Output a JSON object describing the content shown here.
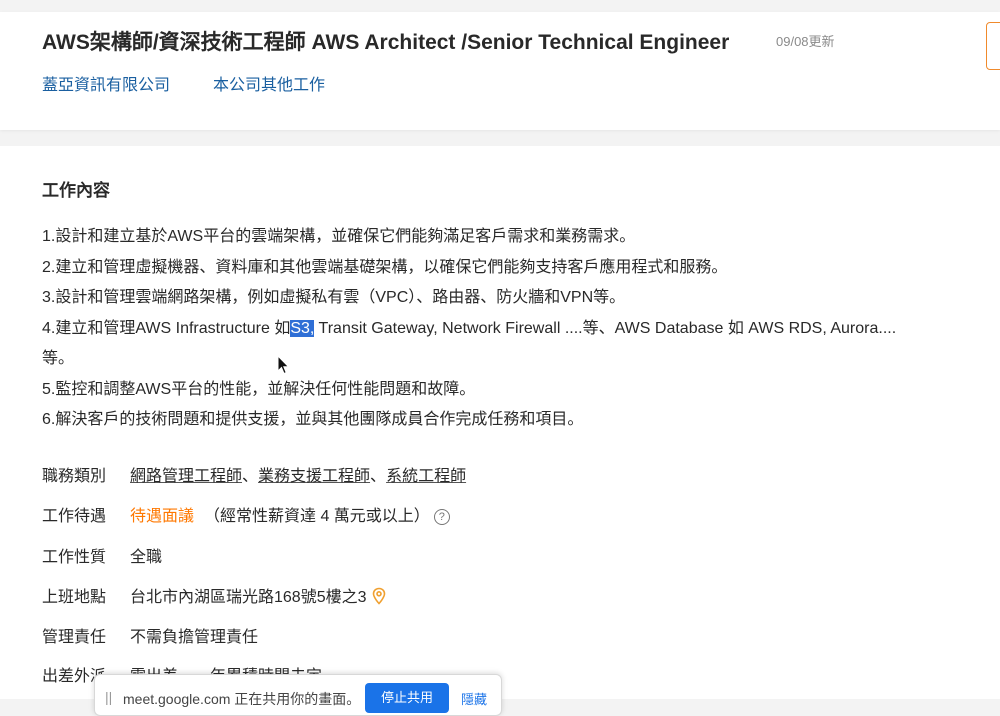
{
  "header": {
    "title": "AWS架構師/資深技術工程師 AWS Architect /Senior Technical Engineer",
    "update_date": "09/08更新",
    "company": "蓋亞資訊有限公司",
    "other_jobs": "本公司其他工作"
  },
  "description": {
    "section_title": "工作內容",
    "lines": [
      "1.設計和建立基於AWS平台的雲端架構，並確保它們能夠滿足客戶需求和業務需求。",
      "2.建立和管理虛擬機器、資料庫和其他雲端基礎架構，以確保它們能夠支持客戶應用程式和服務。",
      "3.設計和管理雲端網路架構，例如虛擬私有雲（VPC）、路由器、防火牆和VPN等。",
      "4.建立和管理AWS Infrastructure 如",
      "S3,",
      " Transit Gateway, Network Firewall ....等、AWS Database 如 AWS RDS, Aurora....",
      "等。",
      "5.監控和調整AWS平台的性能，並解決任何性能問題和故障。",
      "6.解決客戶的技術問題和提供支援，並與其他團隊成員合作完成任務和項目。"
    ]
  },
  "info": {
    "category": {
      "label": "職務類別",
      "items": [
        "網路管理工程師",
        "業務支援工程師",
        "系統工程師"
      ],
      "separator": "、"
    },
    "salary": {
      "label": "工作待遇",
      "value": "待遇面議",
      "note": "（經常性薪資達 4 萬元或以上）",
      "help": "?"
    },
    "job_type": {
      "label": "工作性質",
      "value": "全職"
    },
    "location": {
      "label": "上班地點",
      "value": "台北市內湖區瑞光路168號5樓之3"
    },
    "management": {
      "label": "管理責任",
      "value": "不需負擔管理責任"
    },
    "travel": {
      "label": "出差外派",
      "value": "需出差，一年累積時間未定"
    }
  },
  "share_bar": {
    "text": "meet.google.com 正在共用你的畫面。",
    "stop_label": "停止共用",
    "hide_label": "隱藏"
  },
  "colors": {
    "link": "#1a5fa0",
    "salary": "#ff7800",
    "highlight": "#2f6fd6",
    "apply_border": "#f08a2c"
  }
}
